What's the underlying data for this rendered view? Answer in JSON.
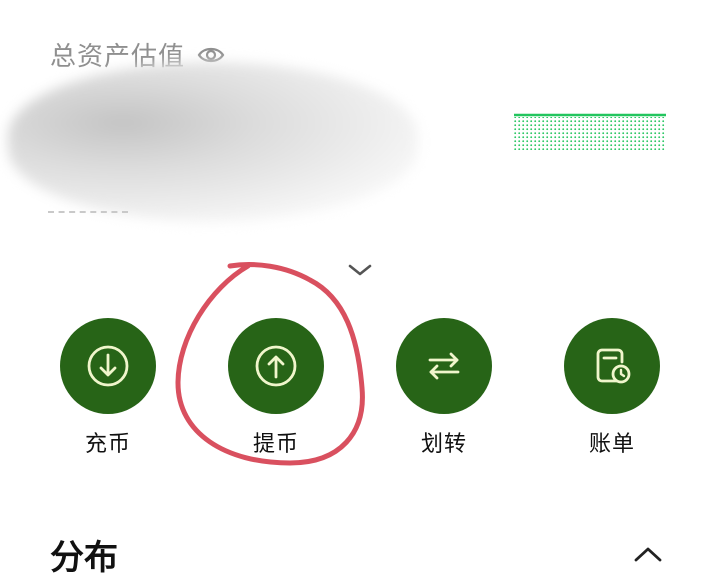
{
  "header": {
    "total_assets_label": "总资产估值",
    "eye_icon": "eye-icon",
    "expand_icon": "chevron-down-icon"
  },
  "colors": {
    "accent_green": "#276417",
    "sparkline_green": "#22c55e",
    "annotation_red": "#d9505f"
  },
  "actions": [
    {
      "label": "充币",
      "icon": "deposit-arrow-down-icon"
    },
    {
      "label": "提币",
      "icon": "withdraw-arrow-up-icon"
    },
    {
      "label": "划转",
      "icon": "transfer-arrows-icon"
    },
    {
      "label": "账单",
      "icon": "bill-clock-icon"
    }
  ],
  "section": {
    "title": "分布",
    "collapse_icon": "chevron-up-icon"
  }
}
